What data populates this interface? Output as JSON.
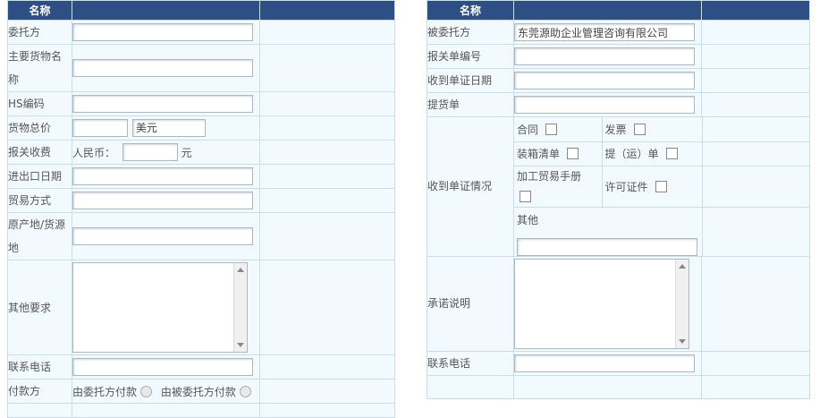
{
  "left_form": {
    "header": "名称",
    "rows": {
      "client": {
        "label": "委托方",
        "value": ""
      },
      "goods_name": {
        "label": "主要货物名称",
        "value": ""
      },
      "hs_code": {
        "label": "HS编码",
        "value": ""
      },
      "total_price": {
        "label": "货物总价",
        "value": "",
        "currency": "美元"
      },
      "customs_fee": {
        "label": "报关收费",
        "rmb_label": "人民币：",
        "value": "",
        "unit": "元"
      },
      "ie_date": {
        "label": "进出口日期",
        "value": ""
      },
      "trade_mode": {
        "label": "贸易方式",
        "value": ""
      },
      "origin": {
        "label": "原产地/货源地",
        "value": ""
      },
      "other_req": {
        "label": "其他要求",
        "value": ""
      },
      "phone": {
        "label": "联系电话",
        "value": ""
      },
      "payer": {
        "label": "付款方",
        "option1": "由委托方付款",
        "option2": "由被委托方付款"
      }
    }
  },
  "right_form": {
    "header": "名称",
    "rows": {
      "trustee": {
        "label": "被委托方",
        "value": "东莞源助企业管理咨询有限公司"
      },
      "decl_no": {
        "label": "报关单编号",
        "value": ""
      },
      "recv_date": {
        "label": "收到单证日期",
        "value": ""
      },
      "bol": {
        "label": "提货单",
        "value": ""
      },
      "docs": {
        "label": "收到单证情况",
        "contract": "合同",
        "invoice": "发票",
        "packing": "装箱清单",
        "lading": "提（运）单",
        "processing": "加工贸易手册",
        "license": "许可证件",
        "other": "其他",
        "other_value": ""
      },
      "commitment": {
        "label": "承诺说明",
        "value": ""
      },
      "phone": {
        "label": "联系电话",
        "value": ""
      }
    }
  }
}
